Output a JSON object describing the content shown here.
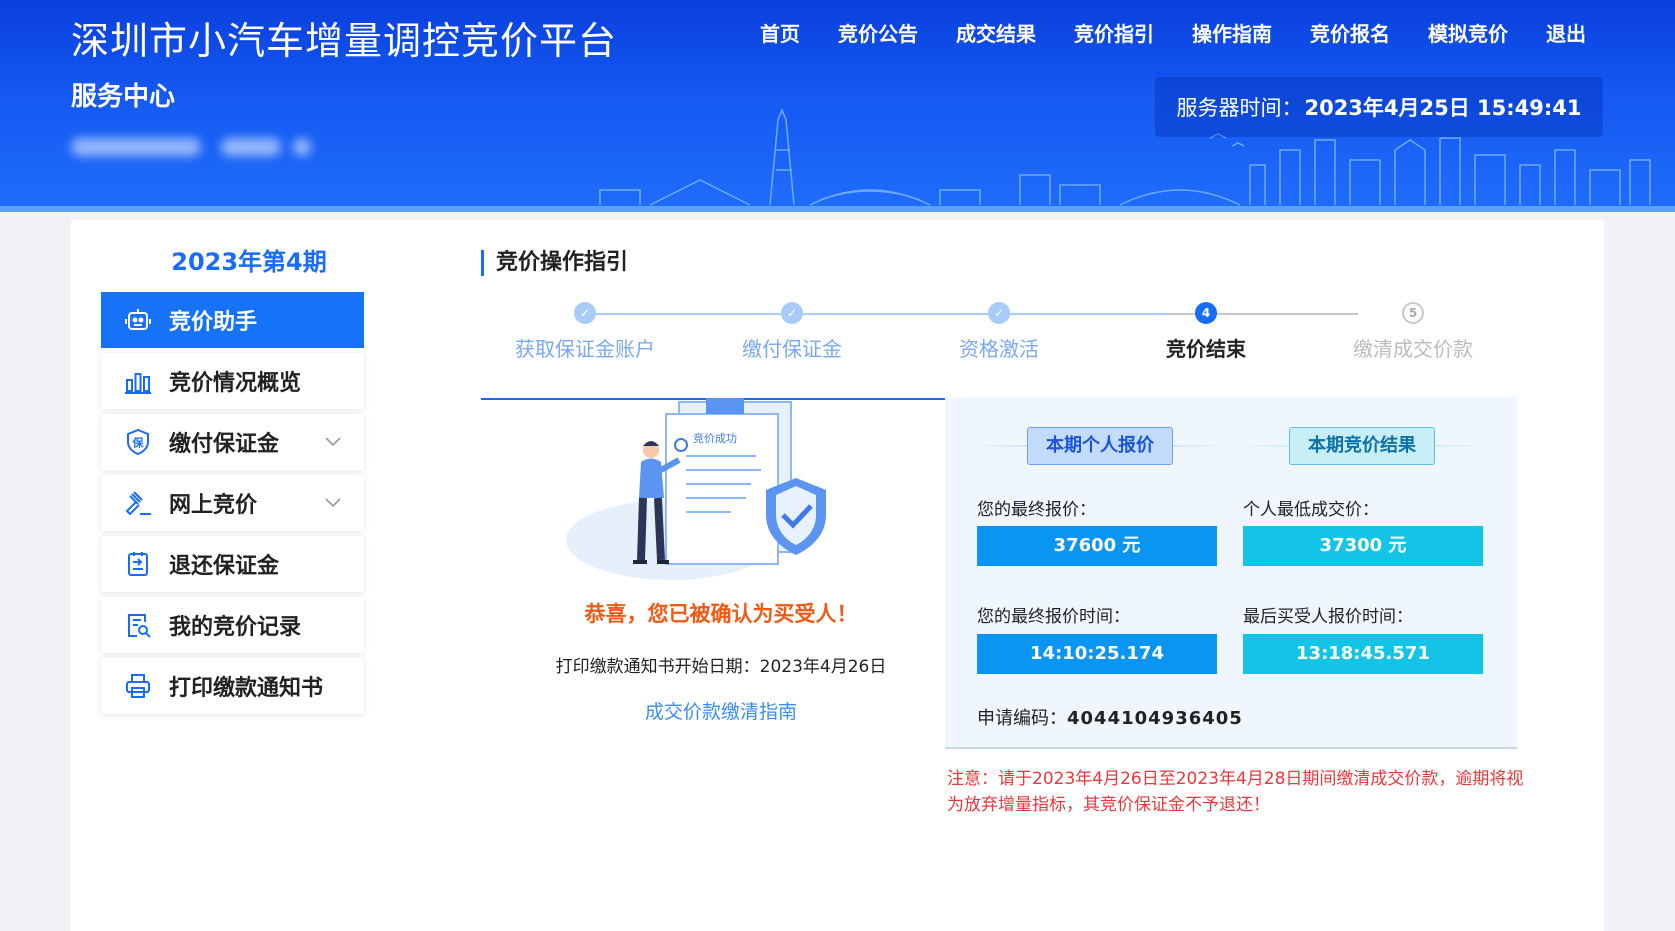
{
  "header": {
    "title": "深圳市小汽车增量调控竞价平台",
    "subtitle": "服务中心",
    "nav": [
      "首页",
      "竞价公告",
      "成交结果",
      "竞价指引",
      "操作指南",
      "竞价报名",
      "模拟竞价",
      "退出"
    ],
    "server_time_label": "服务器时间：",
    "server_time_value": "2023年4月25日 15:49:41"
  },
  "sidebar": {
    "period": "2023年第4期",
    "items": [
      {
        "label": "竞价助手",
        "icon": "robot-icon",
        "active": true
      },
      {
        "label": "竞价情况概览",
        "icon": "bar-chart-icon"
      },
      {
        "label": "缴付保证金",
        "icon": "shield-bao-icon",
        "expandable": true
      },
      {
        "label": "网上竞价",
        "icon": "gavel-icon",
        "expandable": true
      },
      {
        "label": "退还保证金",
        "icon": "refund-doc-icon"
      },
      {
        "label": "我的竞价记录",
        "icon": "record-search-icon"
      },
      {
        "label": "打印缴款通知书",
        "icon": "printer-icon"
      }
    ]
  },
  "content": {
    "section_title": "竞价操作指引",
    "steps": [
      {
        "label": "获取保证金账户",
        "state": "done"
      },
      {
        "label": "缴付保证金",
        "state": "done"
      },
      {
        "label": "资格激活",
        "state": "done"
      },
      {
        "label": "竞价结束",
        "state": "current",
        "number": "4"
      },
      {
        "label": "缴清成交价款",
        "state": "todo",
        "number": "5"
      }
    ],
    "illustration_text": "竞价成功",
    "congrats": "恭喜，您已被确认为买受人！",
    "print_date": "打印缴款通知书开始日期：2023年4月26日",
    "guide_link": "成交价款缴清指南"
  },
  "result": {
    "personal_tag": "本期个人报价",
    "result_tag": "本期竞价结果",
    "final_bid_label": "您的最终报价：",
    "final_bid_value": "37600 元",
    "lowest_price_label": "个人最低成交价：",
    "lowest_price_value": "37300 元",
    "final_bid_time_label": "您的最终报价时间：",
    "final_bid_time_value": "14:10:25.174",
    "last_buyer_time_label": "最后买受人报价时间：",
    "last_buyer_time_value": "13:18:45.571",
    "app_code_label": "申请编码：",
    "app_code_value": "4044104936405"
  },
  "notice": "注意：请于2023年4月26日至2023年4月28日期间缴清成交价款，逾期将视为放弃增量指标，其竞价保证金不予退还！",
  "colors": {
    "primary": "#1673f7",
    "header": "#1559f2",
    "orange": "#f05a14",
    "red": "#e8383d",
    "cyan": "#14c4e6"
  }
}
